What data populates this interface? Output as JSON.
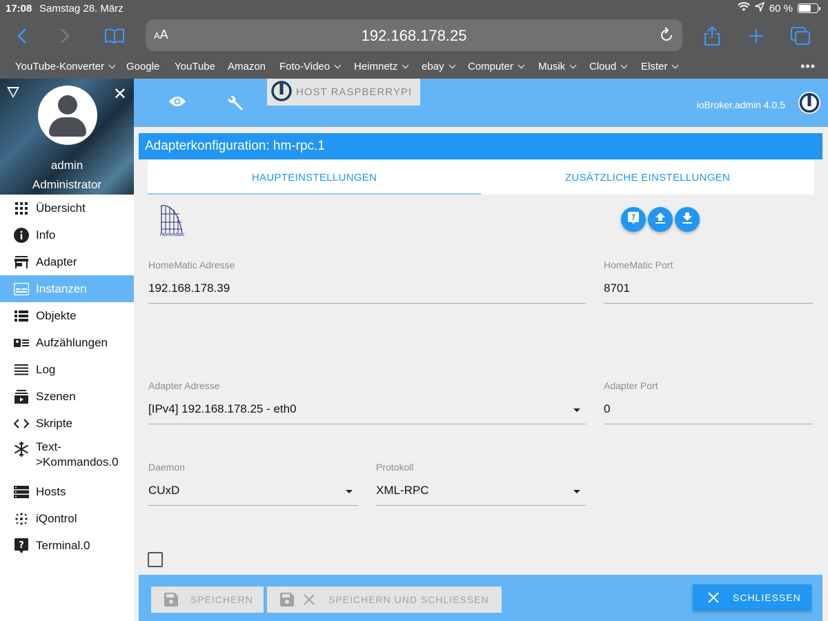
{
  "status": {
    "time": "17:08",
    "date": "Samstag 28. März",
    "battery": "60 %"
  },
  "browser": {
    "text_size": "AA",
    "url": "192.168.178.25",
    "bookmarks": [
      {
        "label": "YouTube-Konverter",
        "folder": true
      },
      {
        "label": "Google",
        "folder": false
      },
      {
        "label": "YouTube",
        "folder": false
      },
      {
        "label": "Amazon",
        "folder": false
      },
      {
        "label": "Foto-Video",
        "folder": true
      },
      {
        "label": "Heimnetz",
        "folder": true
      },
      {
        "label": "ebay",
        "folder": true
      },
      {
        "label": "Computer",
        "folder": true
      },
      {
        "label": "Musik",
        "folder": true
      },
      {
        "label": "Cloud",
        "folder": true
      },
      {
        "label": "Elster",
        "folder": true
      }
    ],
    "more": "•••"
  },
  "sidebar": {
    "user": "admin",
    "role": "Administrator",
    "items": [
      {
        "label": "Übersicht",
        "icon": "grid-icon"
      },
      {
        "label": "Info",
        "icon": "info-icon"
      },
      {
        "label": "Adapter",
        "icon": "store-icon"
      },
      {
        "label": "Instanzen",
        "icon": "instances-icon",
        "active": true
      },
      {
        "label": "Objekte",
        "icon": "list-icon"
      },
      {
        "label": "Aufzählungen",
        "icon": "enum-icon"
      },
      {
        "label": "Log",
        "icon": "log-icon"
      },
      {
        "label": "Szenen",
        "icon": "scenes-icon"
      },
      {
        "label": "Skripte",
        "icon": "code-icon"
      },
      {
        "label": "Text->Kommandos.0",
        "icon": "snowflake-icon"
      },
      {
        "label": "Hosts",
        "icon": "hosts-icon"
      },
      {
        "label": "iQontrol",
        "icon": "dots-icon"
      },
      {
        "label": "Terminal.0",
        "icon": "help-icon"
      }
    ]
  },
  "header": {
    "host": "HOST RASPBERRYPI",
    "version": "ioBroker.admin 4.0.5"
  },
  "config": {
    "title": "Adapterkonfiguration: hm-rpc.1",
    "tabs": [
      "HAUPTEINSTELLUNGEN",
      "ZUSÄTZLICHE EINSTELLUNGEN"
    ],
    "logo_text": "HomeMatic",
    "fields": {
      "hm_address": {
        "label": "HomeMatic Adresse",
        "value": "192.168.178.39"
      },
      "hm_port": {
        "label": "HomeMatic Port",
        "value": "8701"
      },
      "adapter_address": {
        "label": "Adapter Adresse",
        "value": "[IPv4] 192.168.178.25 - eth0"
      },
      "adapter_port": {
        "label": "Adapter Port",
        "value": "0"
      },
      "daemon": {
        "label": "Daemon",
        "value": "CUxD"
      },
      "protocol": {
        "label": "Protokoll",
        "value": "XML-RPC"
      }
    }
  },
  "footer": {
    "save": "SPEICHERN",
    "save_close": "SPEICHERN UND SCHLIESSEN",
    "close": "SCHLIESSEN"
  }
}
